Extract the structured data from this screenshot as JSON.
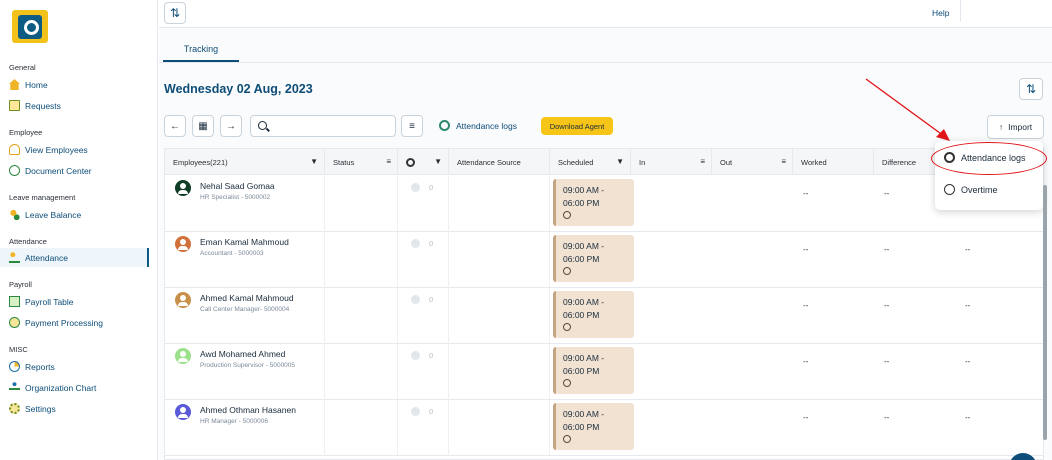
{
  "sidebar": {
    "sections": {
      "general": "General",
      "employee": "Employee",
      "leave": "Leave management",
      "attendance": "Attendance",
      "payroll": "Payroll",
      "misc": "MISC"
    },
    "items": {
      "home": "Home",
      "requests": "Requests",
      "view_employees": "View Employees",
      "document_center": "Document Center",
      "leave_balance": "Leave Balance",
      "attendance": "Attendance",
      "payroll_table": "Payroll Table",
      "payment_processing": "Payment Processing",
      "reports": "Reports",
      "organization_chart": "Organization Chart",
      "settings": "Settings"
    }
  },
  "topbar": {
    "help": "Help"
  },
  "tabs": {
    "tracking": "Tracking"
  },
  "date_title": "Wednesday 02 Aug, 2023",
  "toolbar": {
    "search_placeholder": "",
    "attendance_logs": "Attendance logs",
    "download_agent": "Download Agent",
    "import": "Import"
  },
  "table": {
    "headers": {
      "employees": "Employees(221)",
      "status": "Status",
      "attendance_source": "Attendance Source",
      "scheduled": "Scheduled",
      "in": "In",
      "out": "Out",
      "worked": "Worked",
      "difference": "Difference"
    },
    "rows": [
      {
        "name": "Nehal Saad Gomaa",
        "role": "HR Specialist - 5000002",
        "count": "0",
        "sched_start": "09:00 AM -",
        "sched_end": "06:00 PM",
        "worked": "--",
        "difference": "--",
        "extra": "",
        "avatar_color": "#0f3d26"
      },
      {
        "name": "Eman Kamal Mahmoud",
        "role": "Accountant - 5000003",
        "count": "0",
        "sched_start": "09:00 AM -",
        "sched_end": "06:00 PM",
        "worked": "--",
        "difference": "--",
        "extra": "--",
        "avatar_color": "#d2703a"
      },
      {
        "name": "Ahmed Kamal Mahmoud",
        "role": "Call Center Manager- 5000004",
        "count": "0",
        "sched_start": "09:00 AM -",
        "sched_end": "06:00 PM",
        "worked": "--",
        "difference": "--",
        "extra": "--",
        "avatar_color": "#c9904a"
      },
      {
        "name": "Awd Mohamed Ahmed",
        "role": "Production Supervisor - 5000005",
        "count": "0",
        "sched_start": "09:00 AM -",
        "sched_end": "06:00 PM",
        "worked": "--",
        "difference": "--",
        "extra": "--",
        "avatar_color": "#9be08a"
      },
      {
        "name": "Ahmed Othman Hasanen",
        "role": "HR Manager - 5000006",
        "count": "0",
        "sched_start": "09:00 AM -",
        "sched_end": "06:00 PM",
        "worked": "--",
        "difference": "--",
        "extra": "--",
        "avatar_color": "#5a5ad8"
      }
    ]
  },
  "dropdown": {
    "attendance_logs": "Attendance logs",
    "overtime": "Overtime"
  },
  "colors": {
    "brand": "#0d4d78",
    "accent": "#f7c518",
    "annotation": "#e0161b"
  }
}
